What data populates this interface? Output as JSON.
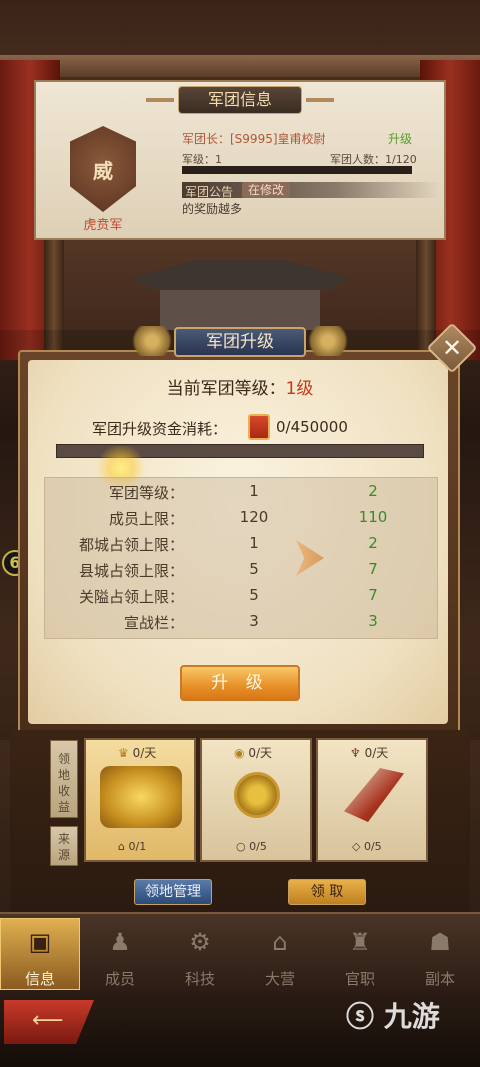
{
  "info_panel": {
    "title": "军团信息",
    "emblem_char": "威",
    "legion_name": "虎贲军",
    "leader": "军团长：[S9995]皇甫校尉",
    "upgrade_link": "升级",
    "level": "军级：1",
    "members": "军团人数：1/120",
    "notice_label": "军团公告",
    "notice_badge": "在修改",
    "notice_text": "的奖励越多"
  },
  "modal": {
    "title": "军团升级",
    "current_level_label": "当前军团等级：",
    "current_level_value": "1级",
    "cost_label": "军团升级资金消耗：",
    "cost_value": "0/450000",
    "progress": 0,
    "stats": [
      {
        "name": "军团等级：",
        "current": "1",
        "next": "2"
      },
      {
        "name": "成员上限：",
        "current": "120",
        "next": "110"
      },
      {
        "name": "都城占领上限：",
        "current": "1",
        "next": "2"
      },
      {
        "name": "县城占领上限：",
        "current": "5",
        "next": "7"
      },
      {
        "name": "关隘占领上限：",
        "current": "5",
        "next": "7"
      },
      {
        "name": "宣战栏：",
        "current": "3",
        "next": "3"
      }
    ],
    "upgrade_button": "升 级",
    "close_icon": "close-icon"
  },
  "territory": {
    "side_tab_income": "领地收益",
    "side_tab_source": "来源",
    "cards": [
      {
        "rate": "0/天",
        "count": "0/1"
      },
      {
        "rate": "0/天",
        "count": "0/5"
      },
      {
        "rate": "0/天",
        "count": "0/5"
      }
    ],
    "manage_button": "领地管理",
    "claim_button": "领 取"
  },
  "nav": [
    {
      "label": "信息",
      "icon": "book-icon",
      "active": true
    },
    {
      "label": "成员",
      "icon": "members-icon",
      "active": false
    },
    {
      "label": "科技",
      "icon": "tech-icon",
      "active": false
    },
    {
      "label": "大营",
      "icon": "camp-icon",
      "active": false
    },
    {
      "label": "官职",
      "icon": "official-icon",
      "active": false
    },
    {
      "label": "副本",
      "icon": "dungeon-icon",
      "active": false
    }
  ],
  "side_badge": "6",
  "watermark": "九游",
  "colors": {
    "accent": "#e89028",
    "upgrade_green": "#3a8a2a",
    "level_red": "#c4381a"
  }
}
